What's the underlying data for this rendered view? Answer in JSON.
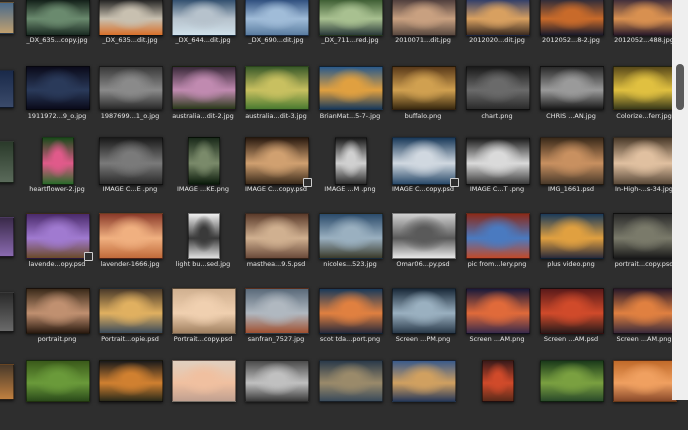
{
  "rows": [
    {
      "items": [
        {
          "name": "_DX_635...copy.jpg",
          "colors": [
            "#0e1a14",
            "#6a8a6e",
            "#1a2a22"
          ]
        },
        {
          "name": "_DX_635...dit.jpg",
          "colors": [
            "#1c1c1c",
            "#c8c0b0",
            "#d8702a"
          ]
        },
        {
          "name": "_DX_644...dit.jpg",
          "colors": [
            "#2c4a6a",
            "#b6c2cc",
            "#cfe0ea"
          ]
        },
        {
          "name": "_DX_690...dit.jpg",
          "colors": [
            "#2a4a7a",
            "#a0bcd8",
            "#5a7ca0"
          ]
        },
        {
          "name": "_DX_711...red.jpg",
          "colors": [
            "#3a5a30",
            "#a8c090",
            "#2a3a3a"
          ]
        },
        {
          "name": "2010071...dit.jpg",
          "colors": [
            "#4a3a3a",
            "#c8a080",
            "#5a4a40"
          ]
        },
        {
          "name": "2012020...dit.jpg",
          "colors": [
            "#2a3a6a",
            "#d8a060",
            "#3a2a20"
          ]
        },
        {
          "name": "2012052...8-2.jpg",
          "colors": [
            "#2a2a3a",
            "#c86a2a",
            "#1a1a2a"
          ]
        },
        {
          "name": "2012052...488.jpg",
          "colors": [
            "#3a2a3a",
            "#d89050",
            "#2a1a2a"
          ]
        }
      ]
    },
    {
      "items": [
        {
          "name": "1911972...9_o.jpg",
          "colors": [
            "#0a0a1a",
            "#2a3a5a",
            "#0a0a1a"
          ]
        },
        {
          "name": "1987699...1_o.jpg",
          "colors": [
            "#3a3a3a",
            "#8a8a8a",
            "#2a2a2a"
          ]
        },
        {
          "name": "australia...dit-2.jpg",
          "colors": [
            "#3a2a3a",
            "#c08ab0",
            "#2a3a1a"
          ]
        },
        {
          "name": "australia...dit-3.jpg",
          "colors": [
            "#3a5a2a",
            "#c8c060",
            "#4a7a30"
          ]
        },
        {
          "name": "BrianMat...5-7-.jpg",
          "colors": [
            "#2a5a8a",
            "#e0a040",
            "#1a3a5a"
          ]
        },
        {
          "name": "buffalo.png",
          "colors": [
            "#5a3a1a",
            "#d0a050",
            "#3a2a10"
          ]
        },
        {
          "name": "chart.png",
          "colors": [
            "#1a1a1a",
            "#6a6a6a",
            "#2a2a2a"
          ]
        },
        {
          "name": "CHRIS ...AN.jpg",
          "colors": [
            "#2a2a2a",
            "#9a9a9a",
            "#1a1a1a"
          ]
        },
        {
          "name": "Colorize...ferr.jpg",
          "colors": [
            "#5a4a1a",
            "#e0c040",
            "#3a3a1a"
          ]
        }
      ]
    },
    {
      "items": [
        {
          "name": "heartflower-2.jpg",
          "colors": [
            "#1a4a1a",
            "#e05a8a",
            "#2a6a2a"
          ],
          "w": 30
        },
        {
          "name": "IMAGE C...E .png",
          "colors": [
            "#1a1a1a",
            "#7a7a7a",
            "#2a2a2a"
          ]
        },
        {
          "name": "IMAGE ...KE.png",
          "colors": [
            "#1a2a1a",
            "#7a8a6a",
            "#0a1a0a"
          ],
          "w": 30
        },
        {
          "name": "IMAGE C...copy.psd",
          "colors": [
            "#2a1a10",
            "#d0a070",
            "#3a2a1a"
          ],
          "stack": true
        },
        {
          "name": "IMAGE ...M .png",
          "colors": [
            "#1a1a1a",
            "#d0d0d0",
            "#2a2a2a"
          ],
          "w": 30
        },
        {
          "name": "IMAGE C...copy.psd",
          "colors": [
            "#1a3a5a",
            "#d0d8e0",
            "#2a4a6a"
          ],
          "stack": true
        },
        {
          "name": "IMAGE C...T .png",
          "colors": [
            "#1a1a1a",
            "#dadada",
            "#3a3a3a"
          ]
        },
        {
          "name": "IMG_1661.psd",
          "colors": [
            "#3a2a1a",
            "#c89060",
            "#4a3a2a"
          ]
        },
        {
          "name": "In-High-...s-34.jpg",
          "colors": [
            "#4a3a2a",
            "#e0c0a0",
            "#5a4a3a"
          ]
        }
      ]
    },
    {
      "items": [
        {
          "name": "lavende...opy.psd",
          "colors": [
            "#4a2a6a",
            "#a07ad0",
            "#6a4a2a"
          ],
          "stack": true
        },
        {
          "name": "lavender-1666.jpg",
          "colors": [
            "#8a3a2a",
            "#f0b080",
            "#c06a3a"
          ]
        },
        {
          "name": "light bu...sed.jpg",
          "colors": [
            "#f0f0f0",
            "#3a3a3a",
            "#e0e0e0"
          ],
          "w": 30
        },
        {
          "name": "masthea...9.5.psd",
          "colors": [
            "#5a3a2a",
            "#d0b090",
            "#6a4a3a"
          ]
        },
        {
          "name": "nicoles...523.jpg",
          "colors": [
            "#2a4a6a",
            "#9ab0c0",
            "#3a3a2a"
          ]
        },
        {
          "name": "Omar06...py.psd",
          "colors": [
            "#d0d0d0",
            "#5a5a5a",
            "#e8e8e8"
          ]
        },
        {
          "name": "pic from...lery.png",
          "colors": [
            "#8a2a1a",
            "#4a7ac0",
            "#c04a2a"
          ]
        },
        {
          "name": "plus video.png",
          "colors": [
            "#1a3a5a",
            "#e0a040",
            "#2a2a3a"
          ]
        },
        {
          "name": "portrait...copy.psd",
          "colors": [
            "#2a2a2a",
            "#7a7a6a",
            "#1a1a1a"
          ]
        }
      ]
    },
    {
      "items": [
        {
          "name": "portrait.png",
          "colors": [
            "#3a2a1a",
            "#c09070",
            "#2a1a10"
          ]
        },
        {
          "name": "Portrait...opie.psd",
          "colors": [
            "#4a3a2a",
            "#e0b060",
            "#3a4a5a"
          ]
        },
        {
          "name": "Portrait...copy.psd",
          "colors": [
            "#d0b090",
            "#f0d0b0",
            "#a08060"
          ]
        },
        {
          "name": "sanfran_7527.jpg",
          "colors": [
            "#5a6a7a",
            "#b0b8c0",
            "#a05030"
          ]
        },
        {
          "name": "scot tda...port.png",
          "colors": [
            "#1a3a5a",
            "#e08040",
            "#2a2a3a"
          ]
        },
        {
          "name": "Screen ...PM.png",
          "colors": [
            "#1a2a3a",
            "#9ab0c0",
            "#2a3a4a"
          ]
        },
        {
          "name": "Screen ...AM.png",
          "colors": [
            "#1a1a3a",
            "#e06a3a",
            "#3a2a4a"
          ]
        },
        {
          "name": "Screen ...AM.psd",
          "colors": [
            "#5a1a1a",
            "#d04a2a",
            "#2a1a1a"
          ]
        },
        {
          "name": "Screen ...AM.png",
          "colors": [
            "#2a1a2a",
            "#e08040",
            "#3a2a3a"
          ]
        }
      ]
    },
    {
      "items": [
        {
          "name": "",
          "colors": [
            "#3a5a1a",
            "#6a9a3a",
            "#2a4a1a"
          ]
        },
        {
          "name": "",
          "colors": [
            "#1a1a1a",
            "#d08030",
            "#2a2a1a"
          ]
        },
        {
          "name": "",
          "colors": [
            "#e0d0c0",
            "#f0c0a0",
            "#c0a090"
          ]
        },
        {
          "name": "",
          "colors": [
            "#4a4a4a",
            "#c0c0c0",
            "#3a3a3a"
          ]
        },
        {
          "name": "",
          "colors": [
            "#2a3a4a",
            "#9a8a6a",
            "#3a4a5a"
          ]
        },
        {
          "name": "",
          "colors": [
            "#3a5a8a",
            "#d0a060",
            "#2a3a5a"
          ]
        },
        {
          "name": "",
          "colors": [
            "#3a1a1a",
            "#d04a2a",
            "#5a2a1a"
          ],
          "w": 30
        },
        {
          "name": "",
          "colors": [
            "#1a3a1a",
            "#7aa040",
            "#2a4a2a"
          ]
        },
        {
          "name": "",
          "colors": [
            "#c06a2a",
            "#f0a060",
            "#8a4a2a"
          ]
        }
      ]
    }
  ],
  "left_edge_thumbs": [
    {
      "colors": [
        "#4a6a8a",
        "#c0a070"
      ]
    },
    {
      "colors": [
        "#1a2a4a",
        "#3a4a6a"
      ]
    },
    {
      "colors": [
        "#2a3a2a",
        "#5a6a5a"
      ]
    },
    {
      "colors": [
        "#3a2a4a",
        "#8a6ab0"
      ]
    },
    {
      "colors": [
        "#2a2a2a",
        "#6a6a6a"
      ]
    },
    {
      "colors": [
        "#4a3a2a",
        "#c08040"
      ]
    }
  ],
  "scrollbar": {
    "position": 0.18
  }
}
